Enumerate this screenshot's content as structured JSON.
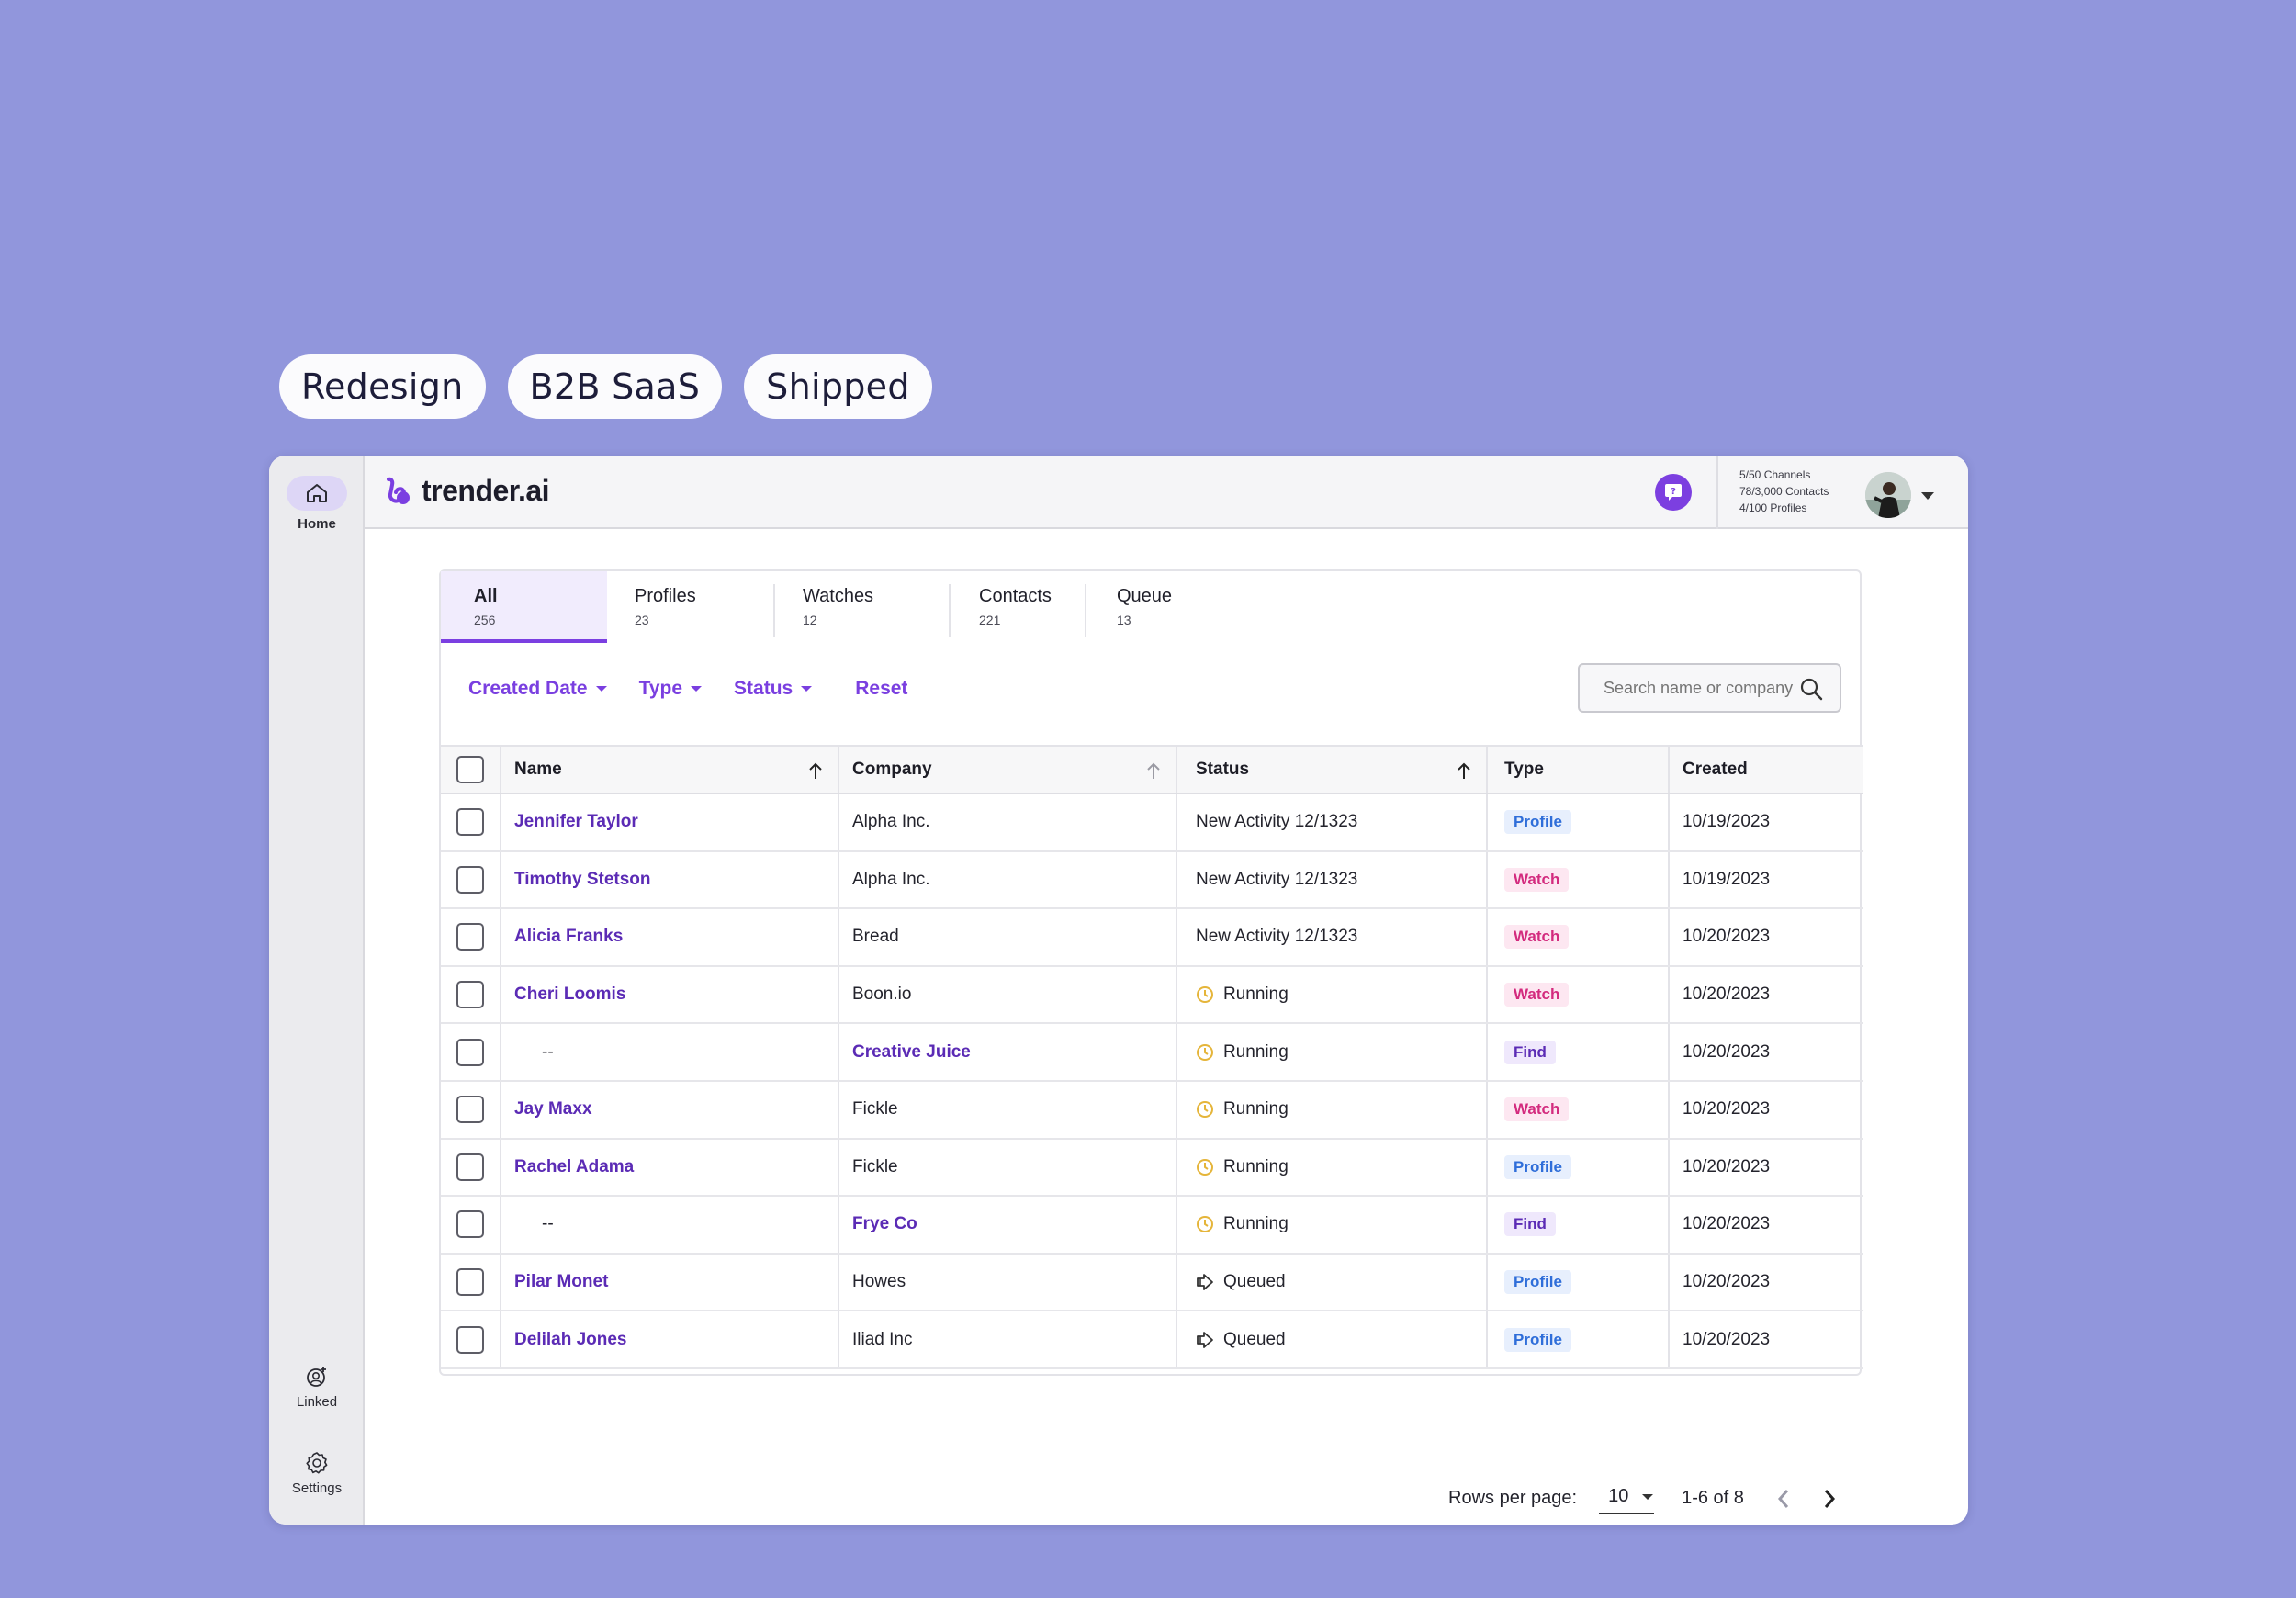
{
  "tags": [
    "Redesign",
    "B2B SaaS",
    "Shipped"
  ],
  "sidebar": {
    "home": {
      "label": "Home",
      "icon": "home-icon"
    },
    "linked": {
      "label": "Linked",
      "icon": "linked-icon"
    },
    "settings": {
      "label": "Settings",
      "icon": "gear-icon"
    }
  },
  "header": {
    "brand": "trender.ai",
    "usage": [
      "5/50 Channels",
      "78/3,000 Contacts",
      "4/100 Profiles"
    ]
  },
  "tabs": [
    {
      "label": "All",
      "count": "256"
    },
    {
      "label": "Profiles",
      "count": "23"
    },
    {
      "label": "Watches",
      "count": "12"
    },
    {
      "label": "Contacts",
      "count": "221"
    },
    {
      "label": "Queue",
      "count": "13"
    }
  ],
  "filters": {
    "created_date": "Created Date",
    "type": "Type",
    "status": "Status",
    "reset": "Reset"
  },
  "search": {
    "placeholder": "Search name or company"
  },
  "table": {
    "headers": {
      "name": "Name",
      "company": "Company",
      "status": "Status",
      "type": "Type",
      "created": "Created"
    },
    "rows": [
      {
        "name": "Jennifer Taylor",
        "company": "Alpha Inc.",
        "status": "New Activity 12/1323",
        "type": "Profile",
        "created": "10/19/2023"
      },
      {
        "name": "Timothy Stetson",
        "company": "Alpha Inc.",
        "status": "New Activity 12/1323",
        "type": "Watch",
        "created": "10/19/2023"
      },
      {
        "name": "Alicia Franks",
        "company": "Bread",
        "status": "New Activity 12/1323",
        "type": "Watch",
        "created": "10/20/2023"
      },
      {
        "name": "Cheri Loomis",
        "company": "Boon.io",
        "status": "Running",
        "type": "Watch",
        "created": "10/20/2023"
      },
      {
        "name": "--",
        "company": "Creative Juice",
        "status": "Running",
        "type": "Find",
        "created": "10/20/2023"
      },
      {
        "name": "Jay Maxx",
        "company": "Fickle",
        "status": "Running",
        "type": "Watch",
        "created": "10/20/2023"
      },
      {
        "name": "Rachel Adama",
        "company": "Fickle",
        "status": "Running",
        "type": "Profile",
        "created": "10/20/2023"
      },
      {
        "name": "--",
        "company": "Frye Co",
        "status": "Running",
        "type": "Find",
        "created": "10/20/2023"
      },
      {
        "name": "Pilar Monet",
        "company": "Howes",
        "status": "Queued",
        "type": "Profile",
        "created": "10/20/2023"
      },
      {
        "name": "Delilah Jones",
        "company": "Iliad Inc",
        "status": "Queued",
        "type": "Profile",
        "created": "10/20/2023"
      }
    ]
  },
  "pagination": {
    "rows_per_page_label": "Rows per page:",
    "rows_per_page": "10",
    "range": "1-6 of 8"
  },
  "colors": {
    "accent": "#7b3fe1",
    "background": "#9196dc",
    "link": "#5b2bb5",
    "running": "#e5b53a"
  }
}
